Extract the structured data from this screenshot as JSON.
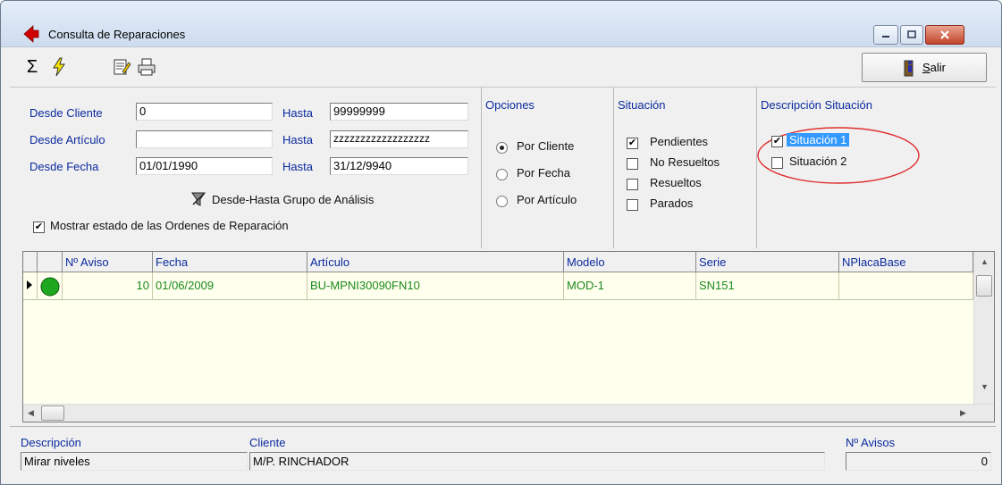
{
  "window": {
    "title": "Consulta de Reparaciones"
  },
  "toolbar": {
    "sum_icon": "Σ",
    "lightning_icon": "⚡",
    "exit_label_u": "S",
    "exit_label_rest": "alir"
  },
  "filters": {
    "desde_cliente_label": "Desde Cliente",
    "desde_cliente_value": "0",
    "hasta_cliente_label": "Hasta",
    "hasta_cliente_value": "99999999",
    "desde_articulo_label": "Desde Artículo",
    "desde_articulo_value": "",
    "hasta_articulo_label": "Hasta",
    "hasta_articulo_value": "zzzzzzzzzzzzzzzzzz",
    "desde_fecha_label": "Desde Fecha",
    "desde_fecha_value": "01/01/1990",
    "hasta_fecha_label": "Hasta",
    "hasta_fecha_value": "31/12/9940",
    "grupo_label": "Desde-Hasta Grupo de Análisis",
    "mostrar_label": "Mostrar estado de las Ordenes de Reparación",
    "mostrar_checked": true
  },
  "opciones": {
    "header": "Opciones",
    "items": [
      {
        "label": "Por Cliente",
        "selected": true
      },
      {
        "label": "Por Fecha",
        "selected": false
      },
      {
        "label": "Por Artículo",
        "selected": false
      }
    ]
  },
  "situacion": {
    "header": "Situación",
    "items": [
      {
        "label": "Pendientes",
        "checked": true
      },
      {
        "label": "No Resueltos",
        "checked": false
      },
      {
        "label": "Resueltos",
        "checked": false
      },
      {
        "label": "Parados",
        "checked": false
      }
    ]
  },
  "descripcion_situacion": {
    "header": "Descripción Situación",
    "items": [
      {
        "label": "Situación 1",
        "checked": true,
        "selected": true
      },
      {
        "label": "Situación 2",
        "checked": false,
        "selected": false
      }
    ],
    "highlight_color": "#3399ff",
    "circle_color": "#e03030"
  },
  "grid": {
    "columns": [
      "Nº Aviso",
      "Fecha",
      "Artículo",
      "Modelo",
      "Serie",
      "NPlacaBase"
    ],
    "rows": [
      {
        "aviso": "10",
        "fecha": "01/06/2009",
        "articulo": "BU-MPNI30090FN10",
        "modelo": "MOD-1",
        "serie": "SN151",
        "nplacabase": "",
        "status_color": "#1fa81f"
      }
    ],
    "background": "#ffffee",
    "text_color": "#1a8a1a"
  },
  "status": {
    "descripcion_label": "Descripción",
    "descripcion_value": "Mirar niveles",
    "cliente_label": "Cliente",
    "cliente_value": "M/P. RINCHADOR",
    "avisos_label": "Nº Avisos",
    "avisos_value": "0"
  }
}
